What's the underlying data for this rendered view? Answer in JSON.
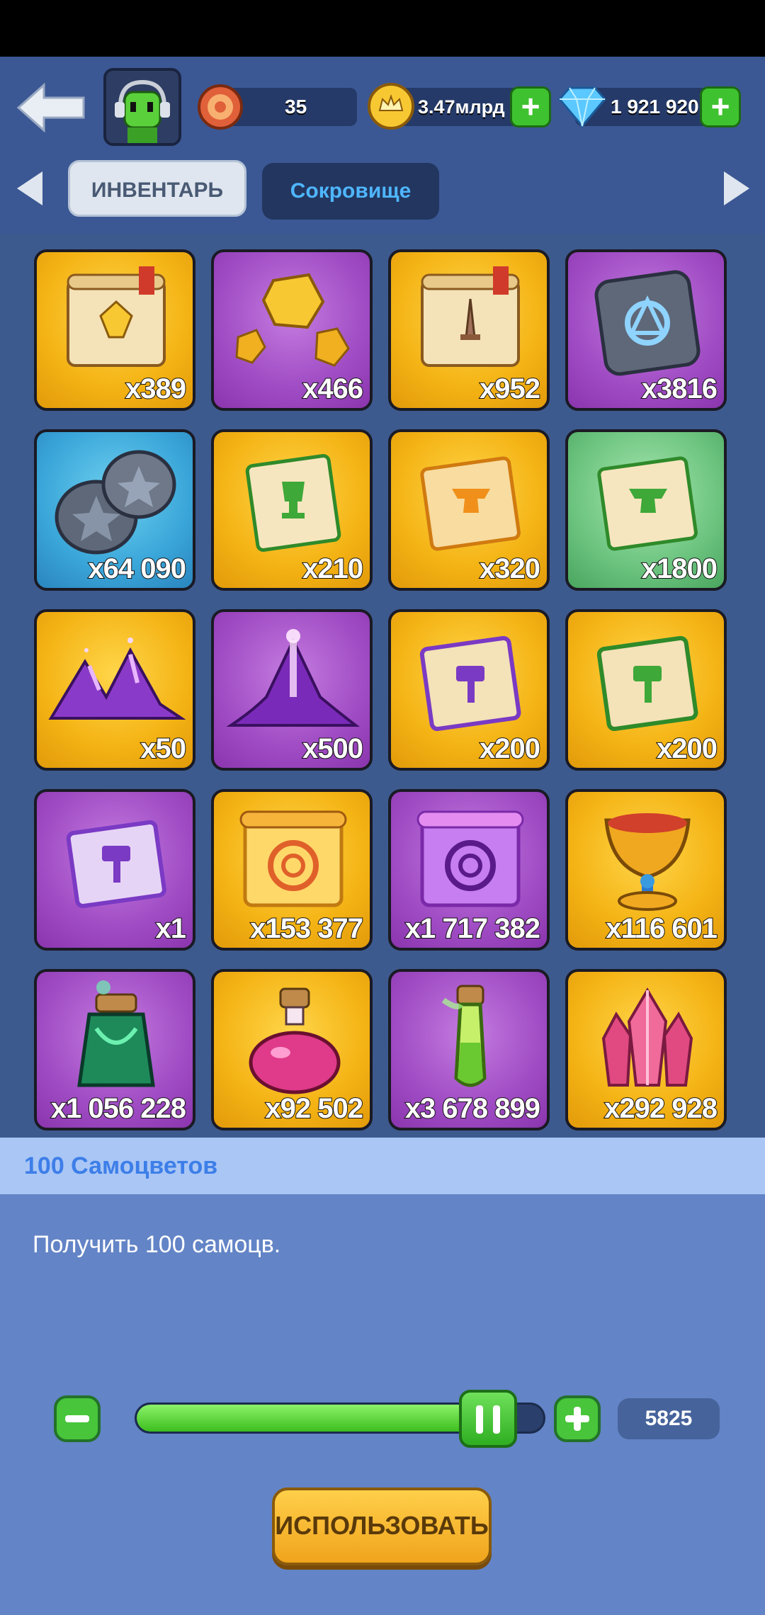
{
  "header": {
    "level": "35",
    "gold": "3.47млрд",
    "gems": "1 921 920"
  },
  "tabs": [
    {
      "label": "ИНВЕНТАРЬ",
      "active": true
    },
    {
      "label": "Сокровище",
      "active": false
    }
  ],
  "items": [
    {
      "name": "gem-fragment-scroll",
      "count": "x389",
      "bg": "gold"
    },
    {
      "name": "gold-nuggets",
      "count": "x466",
      "bg": "purple"
    },
    {
      "name": "sword-scroll",
      "count": "x952",
      "bg": "gold"
    },
    {
      "name": "rune-stone",
      "count": "x3816",
      "bg": "purple"
    },
    {
      "name": "star-coins",
      "count": "x64 090",
      "bg": "blue"
    },
    {
      "name": "trophy-scroll-green",
      "count": "x210",
      "bg": "gold"
    },
    {
      "name": "anvil-scroll-orange",
      "count": "x320",
      "bg": "gold"
    },
    {
      "name": "anvil-scroll-green",
      "count": "x1800",
      "bg": "green"
    },
    {
      "name": "purple-dust-pile",
      "count": "x50",
      "bg": "gold"
    },
    {
      "name": "purple-dust-mound",
      "count": "x500",
      "bg": "purple"
    },
    {
      "name": "hammer-scroll-purple",
      "count": "x200",
      "bg": "gold"
    },
    {
      "name": "hammer-scroll-green",
      "count": "x200",
      "bg": "gold"
    },
    {
      "name": "hammer-scroll-lavender",
      "count": "x1",
      "bg": "purple"
    },
    {
      "name": "swirl-scroll-gold",
      "count": "x153 377",
      "bg": "gold"
    },
    {
      "name": "swirl-scroll-purple",
      "count": "x1 717 382",
      "bg": "purple"
    },
    {
      "name": "golden-chalice",
      "count": "x116 601",
      "bg": "gold"
    },
    {
      "name": "green-bottle",
      "count": "x1 056 228",
      "bg": "purple"
    },
    {
      "name": "pink-potion",
      "count": "x92 502",
      "bg": "gold"
    },
    {
      "name": "green-vial",
      "count": "x3 678 899",
      "bg": "purple"
    },
    {
      "name": "pink-crystal",
      "count": "x292 928",
      "bg": "gold"
    }
  ],
  "panel": {
    "title": "100 Самоцветов",
    "description": "Получить 100 самоцв.",
    "amount": "5825",
    "slider_fraction": 0.87,
    "use_label": "ИСПОЛЬЗОВАТЬ",
    "minus_label": "−",
    "plus_label": "+"
  },
  "colors": {
    "gold": "#f4b314",
    "purple": "#a04cc4",
    "blue": "#3aa6d9",
    "green": "#6cc47f",
    "accent_blue": "#3d7ee8"
  }
}
